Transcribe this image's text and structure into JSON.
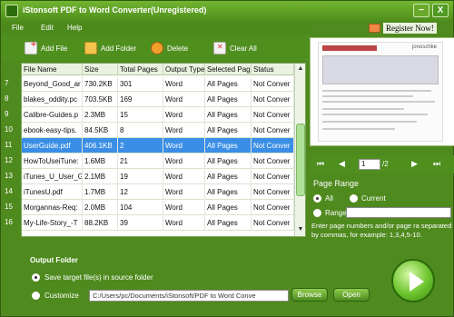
{
  "window": {
    "title": "iStonsoft PDF to Word Converter(Unregistered)",
    "minimize_label": "−",
    "close_label": "X"
  },
  "menu": [
    "File",
    "Edit",
    "Help"
  ],
  "toolbar": {
    "add_file": "Add File",
    "add_folder": "Add Folder",
    "delete": "Delete",
    "clear_all": "Clear All"
  },
  "table": {
    "headers": [
      "File Name",
      "Size",
      "Total Pages",
      "Output Type",
      "Selected Pages",
      "Status"
    ],
    "rows": [
      {
        "num": "7",
        "name": "Beyond_Good_ar",
        "size": "730.2KB",
        "pages": "301",
        "type": "Word",
        "selected": "All Pages",
        "status": "Not Conver"
      },
      {
        "num": "8",
        "name": "blakes_oddity.pc",
        "size": "703.5KB",
        "pages": "169",
        "type": "Word",
        "selected": "All Pages",
        "status": "Not Conver"
      },
      {
        "num": "9",
        "name": "Calibre-Guides.p",
        "size": "2.3MB",
        "pages": "15",
        "type": "Word",
        "selected": "All Pages",
        "status": "Not Conver"
      },
      {
        "num": "10",
        "name": "ebook-easy-tips.",
        "size": "84.5KB",
        "pages": "8",
        "type": "Word",
        "selected": "All Pages",
        "status": "Not Conver"
      },
      {
        "num": "11",
        "name": "UserGuide.pdf",
        "size": "406.1KB",
        "pages": "2",
        "type": "Word",
        "selected": "All Pages",
        "status": "Not Conver"
      },
      {
        "num": "12",
        "name": "HowToUseiTune:",
        "size": "1.6MB",
        "pages": "21",
        "type": "Word",
        "selected": "All Pages",
        "status": "Not Conver"
      },
      {
        "num": "13",
        "name": "iTunes_U_User_G",
        "size": "2.1MB",
        "pages": "19",
        "type": "Word",
        "selected": "All Pages",
        "status": "Not Conver"
      },
      {
        "num": "14",
        "name": "iTunesU.pdf",
        "size": "1.7MB",
        "pages": "12",
        "type": "Word",
        "selected": "All Pages",
        "status": "Not Conver"
      },
      {
        "num": "15",
        "name": "Morgannas-Req:",
        "size": "2.0MB",
        "pages": "104",
        "type": "Word",
        "selected": "All Pages",
        "status": "Not Conver"
      },
      {
        "num": "16",
        "name": "My-Life-Story_-T",
        "size": "88.2KB",
        "pages": "39",
        "type": "Word",
        "selected": "All Pages",
        "status": "Not Conver"
      }
    ],
    "selected_row_index": 4
  },
  "register": {
    "label": "Register Now!"
  },
  "preview": {
    "logo_text": "jonoschke"
  },
  "navigation": {
    "first": "⏮",
    "prev": "◀",
    "current_page": "1",
    "total": "/2",
    "next": "▶",
    "last": "⏭"
  },
  "page_range": {
    "legend": "Page Range",
    "all_label": "All",
    "current_label": "Current",
    "range_label": "Range",
    "selected": "All",
    "range_value": "",
    "hint": "Enter page numbers and/or page ra separated by commas, for example: 1,3,4,5-10."
  },
  "output": {
    "title": "Output Folder",
    "save_source_label": "Save target file(s) in source folder",
    "customize_label": "Customize",
    "path": "C:/Users/pc/Documents/iStonsoft/PDF to Word Conve",
    "browse": "Browse",
    "open": "Open",
    "selected": "source"
  },
  "colors": {
    "frame_green": "#4f8a1e",
    "selected_row": "#3a8ee6",
    "convert_button": "#6cc42d"
  }
}
